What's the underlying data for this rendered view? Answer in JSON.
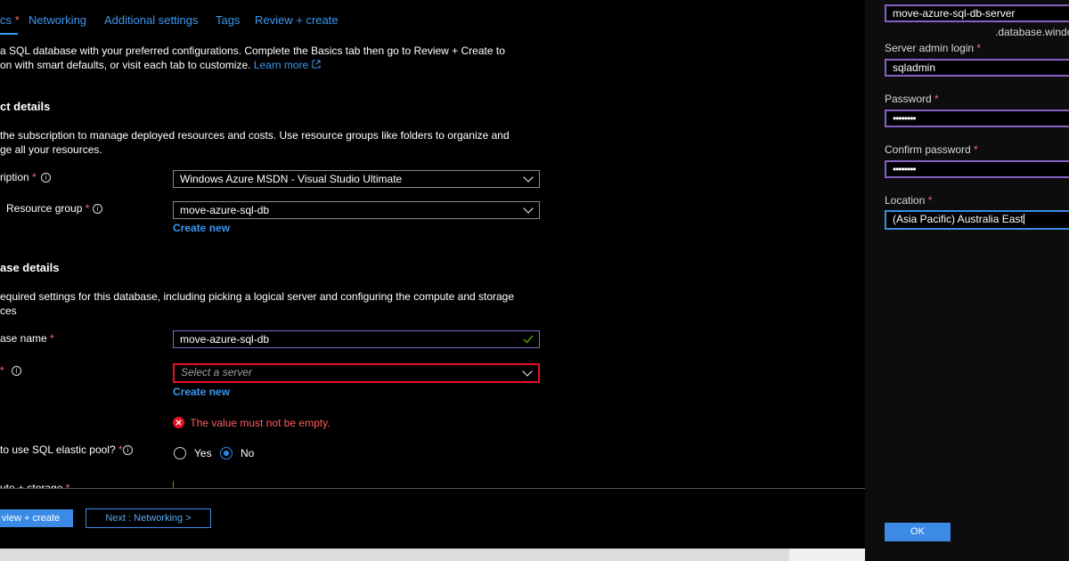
{
  "tabs": {
    "basics": "cs",
    "basics_required": "*",
    "networking": "Networking",
    "additional": "Additional settings",
    "tags": "Tags",
    "review": "Review + create"
  },
  "intro": {
    "line1": "a SQL database with your preferred configurations. Complete the Basics tab then go to Review + Create to",
    "line2": "on with smart defaults, or visit each tab to customize.",
    "learn_more": "Learn more"
  },
  "project": {
    "heading": "ct details",
    "desc1": "the subscription to manage deployed resources and costs. Use resource groups like folders to organize and",
    "desc2": "ge all your resources.",
    "subscription_label": "ription",
    "subscription_value": "Windows Azure MSDN - Visual Studio Ultimate",
    "rg_label": "Resource group",
    "rg_value": "move-azure-sql-db",
    "rg_create": "Create new"
  },
  "database": {
    "heading": "ase details",
    "desc1": "equired settings for this database, including picking a logical server and configuring the compute and storage",
    "desc2": "ces",
    "name_label": "ase name",
    "name_value": "move-azure-sql-db",
    "server_placeholder": "Select a server",
    "server_create": "Create new",
    "server_error": "The value must not be empty.",
    "pool_label": "to use SQL elastic pool?",
    "pool_yes": "Yes",
    "pool_no": "No",
    "pool_selected": "No",
    "compute_label": "ute + storage"
  },
  "footer": {
    "review_button": "view + create",
    "next_button": "Next : Networking >"
  },
  "server_panel": {
    "server_name": "move-azure-sql-db-server",
    "domain_suffix": ".database.windo",
    "admin_label": "Server admin login",
    "admin_value": "sqladmin",
    "password_label": "Password",
    "password_value": "••••••••",
    "confirm_label": "Confirm password",
    "confirm_value": "••••••••",
    "location_label": "Location",
    "location_value": "(Asia Pacific) Australia East",
    "ok_button": "OK"
  },
  "colors": {
    "accent": "#3b97f0",
    "required": "#ff6b6b",
    "error": "#e81123",
    "input_focus": "#8661c5",
    "panel_bg": "#0d0d0d",
    "valid": "#57a300"
  },
  "icons": [
    "info-icon",
    "external-link-icon",
    "chevron-down-icon",
    "check-icon",
    "error-icon",
    "radio-icon"
  ]
}
